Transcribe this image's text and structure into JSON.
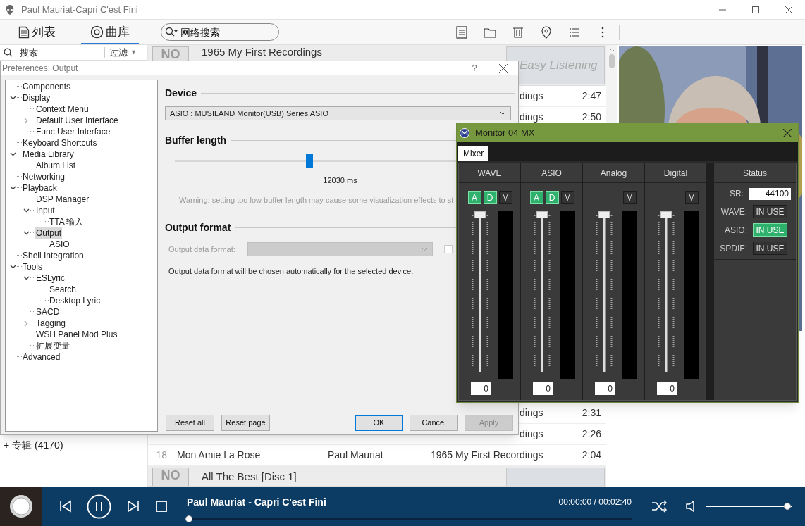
{
  "window": {
    "title": "Paul Mauriat-Capri C'est Fini"
  },
  "toolbar": {
    "tabs": [
      {
        "label": "列表",
        "selected": false
      },
      {
        "label": "曲库",
        "selected": true
      }
    ],
    "search": {
      "placeholder": "网络搜索"
    }
  },
  "library_panel": {
    "search_label": "搜索",
    "filter_label": "过滤",
    "filter_arrow": "▼",
    "groups": [
      {
        "expander": "+",
        "label": "专辑 (4170)"
      }
    ]
  },
  "track_list": {
    "top_album": {
      "cover": "NO",
      "title": "1965 My First Recordings",
      "genre": "Easy Listening"
    },
    "upper_rows": [
      {
        "kind": "fragment",
        "album": "dings",
        "duration": "2:47"
      },
      {
        "kind": "fragment",
        "album": "dings",
        "duration": "2:50"
      }
    ],
    "lower_rows": [
      {
        "kind": "fragment",
        "album": "dings",
        "duration": "2:31"
      },
      {
        "kind": "fragment",
        "album": "dings",
        "duration": "2:26"
      },
      {
        "kind": "full",
        "number": "18",
        "title": "Mon Amie La Rose",
        "artist": "Paul Mauriat",
        "album": "1965 My First Recordings",
        "duration": "2:04"
      }
    ],
    "bottom_album": {
      "cover": "NO",
      "title": "All The Best [Disc 1]"
    }
  },
  "preferences": {
    "title": "Preferences: Output",
    "help": "?",
    "tree": [
      {
        "label": "Components",
        "selected": false
      },
      {
        "label": "Display",
        "expanded": true,
        "selected": false,
        "children": [
          {
            "label": "Context Menu",
            "selected": false
          },
          {
            "label": "Default User Interface",
            "expanded": false,
            "selected": false
          },
          {
            "label": "Func User Interface",
            "selected": false
          }
        ]
      },
      {
        "label": "Keyboard Shortcuts",
        "selected": false
      },
      {
        "label": "Media Library",
        "expanded": true,
        "selected": false,
        "children": [
          {
            "label": "Album List",
            "selected": false
          }
        ]
      },
      {
        "label": "Networking",
        "selected": false
      },
      {
        "label": "Playback",
        "expanded": true,
        "selected": false,
        "children": [
          {
            "label": "DSP Manager",
            "selected": false
          },
          {
            "label": "Input",
            "expanded": true,
            "selected": false,
            "children": [
              {
                "label": "TTA 输入",
                "selected": false
              }
            ]
          },
          {
            "label": "Output",
            "expanded": true,
            "selected": true,
            "children": [
              {
                "label": "ASIO",
                "selected": false
              }
            ]
          }
        ]
      },
      {
        "label": "Shell Integration",
        "selected": false
      },
      {
        "label": "Tools",
        "expanded": true,
        "selected": false,
        "children": [
          {
            "label": "ESLyric",
            "expanded": true,
            "selected": false,
            "children": [
              {
                "label": "Search",
                "selected": false
              },
              {
                "label": "Desktop Lyric",
                "selected": false
              }
            ]
          },
          {
            "label": "SACD",
            "selected": false
          },
          {
            "label": "Tagging",
            "expanded": false,
            "selected": false
          },
          {
            "label": "WSH Panel Mod Plus",
            "selected": false
          },
          {
            "label": "扩展变量",
            "selected": false
          }
        ]
      },
      {
        "label": "Advanced",
        "selected": false
      }
    ],
    "device": {
      "heading": "Device",
      "value": "ASIO : MUSILAND Monitor(USB) Series ASIO"
    },
    "buffer": {
      "heading": "Buffer length",
      "level": 0.4,
      "reading": "12030 ms",
      "warning": "Warning: setting too low buffer length may cause some visualization effects to st"
    },
    "output_format": {
      "heading": "Output format",
      "label": "Output data format:",
      "disabled": true,
      "checked": false,
      "note": "Output data format will be chosen automatically for the selected device."
    },
    "page_buttons": [
      {
        "label": "Reset all",
        "default": false,
        "disabled": false
      },
      {
        "label": "Reset page",
        "default": false,
        "disabled": false
      }
    ],
    "dialog_buttons": [
      {
        "label": "OK",
        "default": true,
        "disabled": false
      },
      {
        "label": "Cancel",
        "default": false,
        "disabled": false
      },
      {
        "label": "Apply",
        "default": false,
        "disabled": true
      }
    ]
  },
  "mixer_window": {
    "title": "Monitor 04 MX",
    "tabs": [
      {
        "label": "Mixer",
        "selected": true
      }
    ],
    "channels": [
      {
        "name": "WAVE",
        "buttons": [
          {
            "label": "A",
            "on": true
          },
          {
            "label": "D",
            "on": true
          },
          {
            "label": "M",
            "on": false
          }
        ],
        "level": 1,
        "value": "0"
      },
      {
        "name": "ASIO",
        "buttons": [
          {
            "label": "A",
            "on": true
          },
          {
            "label": "D",
            "on": true
          },
          {
            "label": "M",
            "on": false
          }
        ],
        "level": 1,
        "value": "0"
      },
      {
        "name": "Analog",
        "buttons": [
          {
            "label": "M",
            "on": false
          }
        ],
        "level": 1,
        "value": "0"
      },
      {
        "name": "Digital",
        "buttons": [
          {
            "label": "M",
            "on": false
          }
        ],
        "level": 1,
        "value": "0"
      }
    ],
    "status": {
      "heading": "Status",
      "rate_label": "SR:",
      "rate": "44100",
      "inputs": [
        {
          "label": "WAVE:",
          "button": "IN USE",
          "on": false
        },
        {
          "label": "ASIO:",
          "button": "IN USE",
          "on": true
        },
        {
          "label": "SPDIF:",
          "button": "IN USE",
          "on": false
        }
      ]
    }
  },
  "player": {
    "title": "Paul Mauriat - Capri C'est Fini",
    "time": "00:00:00 / 00:02:40",
    "playing": true,
    "progress": {
      "level": 0
    },
    "volume": {
      "level": 0.98
    }
  }
}
